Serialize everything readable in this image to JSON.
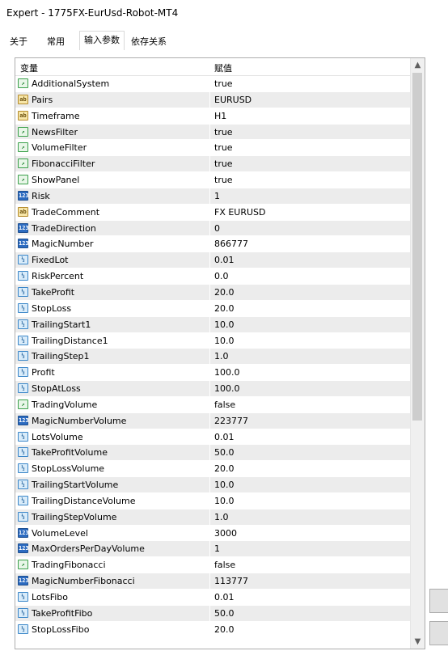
{
  "window": {
    "title": "Expert - 1775FX-EurUsd-Robot-MT4"
  },
  "tabs": [
    {
      "label": "关于"
    },
    {
      "label": "常用"
    },
    {
      "label": "输入参数"
    },
    {
      "label": "依存关系"
    }
  ],
  "active_tab": "输入参数",
  "grid": {
    "col_variable": "变量",
    "col_value": "赋值",
    "rows": [
      {
        "type": "bool",
        "name": "AdditionalSystem",
        "value": "true"
      },
      {
        "type": "str",
        "name": "Pairs",
        "value": "EURUSD"
      },
      {
        "type": "str",
        "name": "Timeframe",
        "value": "H1"
      },
      {
        "type": "bool",
        "name": "NewsFilter",
        "value": "true"
      },
      {
        "type": "bool",
        "name": "VolumeFilter",
        "value": "true"
      },
      {
        "type": "bool",
        "name": "FibonacciFilter",
        "value": "true"
      },
      {
        "type": "bool",
        "name": "ShowPanel",
        "value": "true"
      },
      {
        "type": "int",
        "name": "Risk",
        "value": "1"
      },
      {
        "type": "str",
        "name": "TradeComment",
        "value": "FX EURUSD"
      },
      {
        "type": "int",
        "name": "TradeDirection",
        "value": "0"
      },
      {
        "type": "int",
        "name": "MagicNumber",
        "value": "866777"
      },
      {
        "type": "dbl",
        "name": "FixedLot",
        "value": "0.01"
      },
      {
        "type": "dbl",
        "name": "RiskPercent",
        "value": "0.0"
      },
      {
        "type": "dbl",
        "name": "TakeProfit",
        "value": "20.0"
      },
      {
        "type": "dbl",
        "name": "StopLoss",
        "value": "20.0"
      },
      {
        "type": "dbl",
        "name": "TrailingStart1",
        "value": "10.0"
      },
      {
        "type": "dbl",
        "name": "TrailingDistance1",
        "value": "10.0"
      },
      {
        "type": "dbl",
        "name": "TrailingStep1",
        "value": "1.0"
      },
      {
        "type": "dbl",
        "name": "Profit",
        "value": "100.0"
      },
      {
        "type": "dbl",
        "name": "StopAtLoss",
        "value": "100.0"
      },
      {
        "type": "bool",
        "name": "TradingVolume",
        "value": "false"
      },
      {
        "type": "int",
        "name": "MagicNumberVolume",
        "value": "223777"
      },
      {
        "type": "dbl",
        "name": "LotsVolume",
        "value": "0.01"
      },
      {
        "type": "dbl",
        "name": "TakeProfitVolume",
        "value": "50.0"
      },
      {
        "type": "dbl",
        "name": "StopLossVolume",
        "value": "20.0"
      },
      {
        "type": "dbl",
        "name": "TrailingStartVolume",
        "value": "10.0"
      },
      {
        "type": "dbl",
        "name": "TrailingDistanceVolume",
        "value": "10.0"
      },
      {
        "type": "dbl",
        "name": "TrailingStepVolume",
        "value": "1.0"
      },
      {
        "type": "int",
        "name": "VolumeLevel",
        "value": "3000"
      },
      {
        "type": "int",
        "name": "MaxOrdersPerDayVolume",
        "value": "1"
      },
      {
        "type": "bool",
        "name": "TradingFibonacci",
        "value": "false"
      },
      {
        "type": "int",
        "name": "MagicNumberFibonacci",
        "value": "113777"
      },
      {
        "type": "dbl",
        "name": "LotsFibo",
        "value": "0.01"
      },
      {
        "type": "dbl",
        "name": "TakeProfitFibo",
        "value": "50.0"
      },
      {
        "type": "dbl",
        "name": "StopLossFibo",
        "value": "20.0"
      }
    ]
  },
  "icon_glyphs": {
    "bool": "↗",
    "str": "ab",
    "int": "123",
    "dbl": "½"
  },
  "colors": {
    "row_alt": "#ececec",
    "grid_border": "#adadad"
  }
}
